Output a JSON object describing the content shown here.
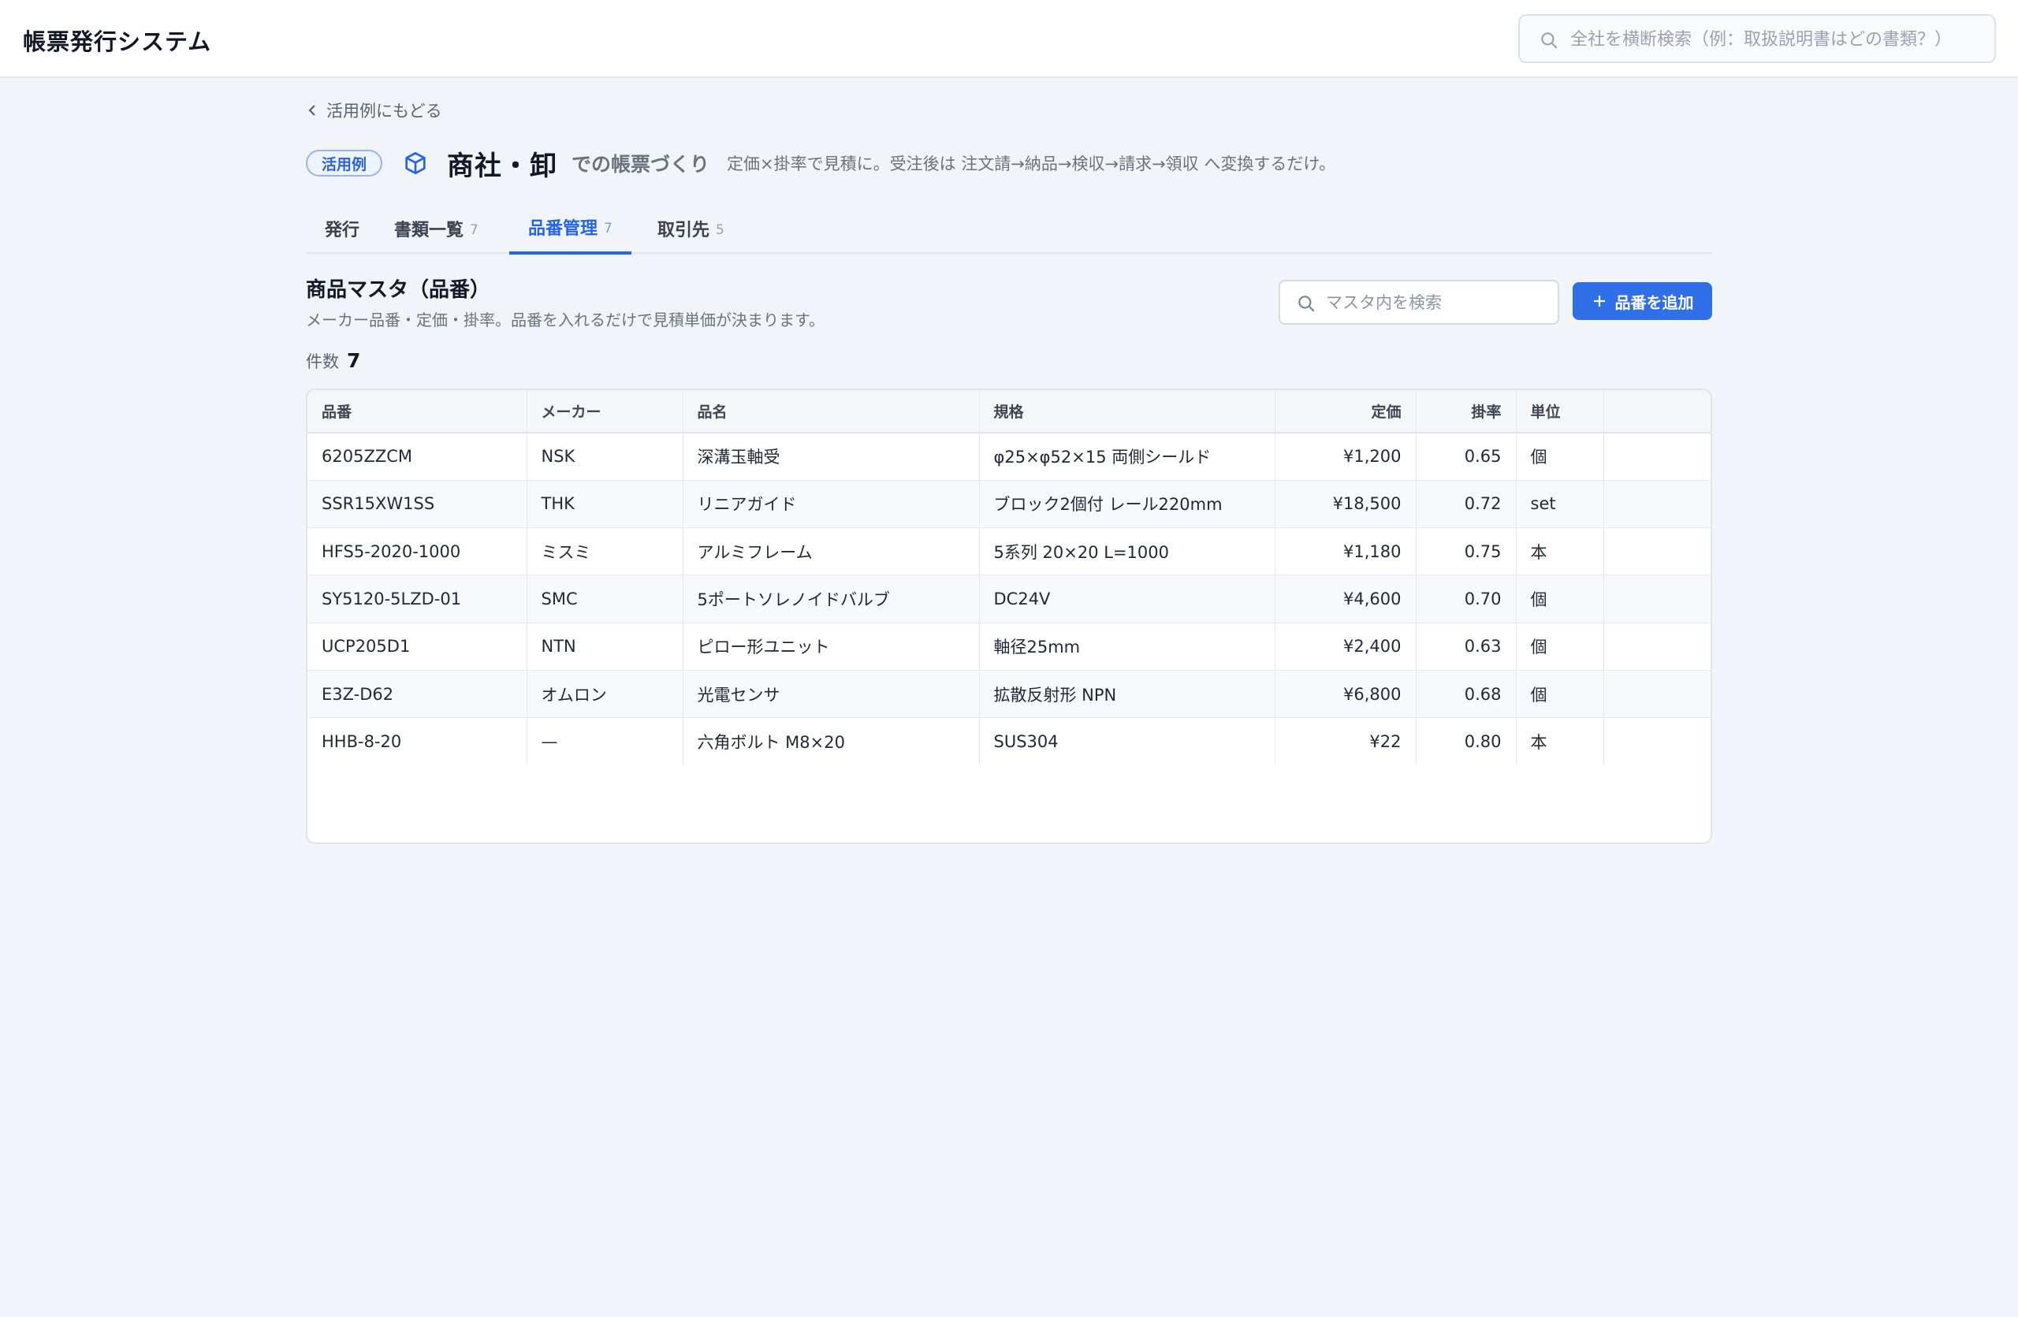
{
  "app": {
    "title": "帳票発行システム"
  },
  "global_search": {
    "placeholder": "全社を横断検索（例：取扱説明書はどの書類？）"
  },
  "back": {
    "label": "活用例にもどる"
  },
  "heading": {
    "badge": "活用例",
    "icon": "cube-icon",
    "title": "商社・卸",
    "suffix": "での帳票づくり",
    "description": "定価×掛率で見積に。受注後は 注文請→納品→検収→請求→領収 へ変換するだけ。"
  },
  "tabs": [
    {
      "label": "発行",
      "count": ""
    },
    {
      "label": "書類一覧",
      "count": "7"
    },
    {
      "label": "品番管理",
      "count": "7",
      "active": true
    },
    {
      "label": "取引先",
      "count": "5"
    }
  ],
  "section": {
    "title": "商品マスタ（品番）",
    "subtitle": "メーカー品番・定価・掛率。品番を入れるだけで見積単価が決まります。"
  },
  "master_search": {
    "placeholder": "マスタ内を検索"
  },
  "add_button": {
    "label": "品番を追加"
  },
  "count": {
    "label": "件数",
    "value": "7"
  },
  "table": {
    "headers": [
      "品番",
      "メーカー",
      "品名",
      "規格",
      "定価",
      "掛率",
      "単位",
      ""
    ],
    "rows": [
      [
        "6205ZZCM",
        "NSK",
        "深溝玉軸受",
        "φ25×φ52×15 両側シールド",
        "¥1,200",
        "0.65",
        "個",
        ""
      ],
      [
        "SSR15XW1SS",
        "THK",
        "リニアガイド",
        "ブロック2個付 レール220mm",
        "¥18,500",
        "0.72",
        "set",
        ""
      ],
      [
        "HFS5-2020-1000",
        "ミスミ",
        "アルミフレーム",
        "5系列 20×20 L=1000",
        "¥1,180",
        "0.75",
        "本",
        ""
      ],
      [
        "SY5120-5LZD-01",
        "SMC",
        "5ポートソレノイドバルブ",
        "DC24V",
        "¥4,600",
        "0.70",
        "個",
        ""
      ],
      [
        "UCP205D1",
        "NTN",
        "ピロー形ユニット",
        "軸径25mm",
        "¥2,400",
        "0.63",
        "個",
        ""
      ],
      [
        "E3Z-D62",
        "オムロン",
        "光電センサ",
        "拡散反射形 NPN",
        "¥6,800",
        "0.68",
        "個",
        ""
      ],
      [
        "HHB-8-20",
        "—",
        "六角ボルト M8×20",
        "SUS304",
        "¥22",
        "0.80",
        "本",
        ""
      ]
    ]
  },
  "colors": {
    "accent": "#2563eb",
    "button": "#2f6fe8",
    "background": "#f1f4f8"
  }
}
